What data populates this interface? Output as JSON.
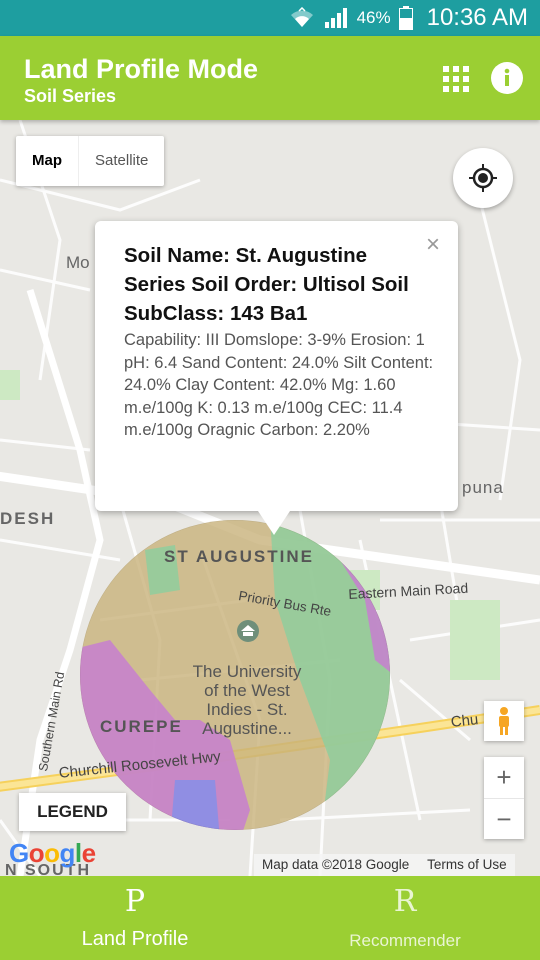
{
  "status_bar": {
    "battery_percent": "46%",
    "time": "10:36 AM"
  },
  "app_bar": {
    "title": "Land Profile Mode",
    "subtitle": "Soil Series",
    "color": "#9bcf33"
  },
  "map": {
    "type_buttons": [
      "Map",
      "Satellite"
    ],
    "active_type": "Map",
    "labels": {
      "st_augustine": "ST AUGUSTINE",
      "priority_bus": "Priority Bus Rte",
      "eastern_main": "Eastern Main Road",
      "university": [
        "The University",
        "of the West",
        "Indies - St.",
        "Augustine..."
      ],
      "curepe": "CUREPE",
      "churchill": "Churchill Roosevelt Hwy",
      "churchill_right": "Chu",
      "southern_main": "Southern Main Rd",
      "desh": "DESH",
      "mo": "Mo",
      "buna": "puna",
      "south": "N SOUTH"
    },
    "info_window": {
      "title": "Soil Name: St. Augustine Series Soil Order: Ultisol Soil SubClass: 143 Ba1",
      "details": "Capability: III Domslope: 3-9% Erosion: 1 pH: 6.4 Sand Content: 24.0% Silt Content: 24.0% Clay Content: 42.0% Mg: 1.60 m.e/100g K: 0.13 m.e/100g CEC: 11.4 m.e/100g Oragnic Carbon: 2.20%",
      "close_symbol": "×"
    },
    "legend_label": "LEGEND",
    "zoom_in": "+",
    "zoom_out": "−",
    "google_logo": "Google",
    "attribution": {
      "map_data": "Map data ©2018 Google",
      "terms": "Terms of Use"
    },
    "overlay_colors": {
      "tan": "#c8b27a",
      "green": "#8fce9e",
      "purple": "#c77fd0",
      "blue": "#8a8fe6"
    }
  },
  "bottom_nav": {
    "items": [
      {
        "icon_letter": "P",
        "label": "Land Profile",
        "active": true
      },
      {
        "icon_letter": "R",
        "label": "Recommender",
        "active": false
      }
    ]
  }
}
